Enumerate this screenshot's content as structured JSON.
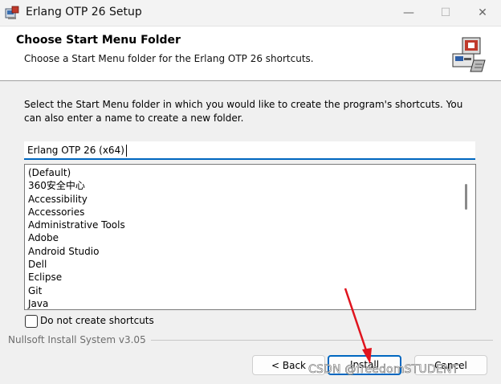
{
  "window": {
    "title": "Erlang OTP 26 Setup",
    "minimize": "—",
    "maximize": "☐",
    "close": "✕"
  },
  "header": {
    "title": "Choose Start Menu Folder",
    "subtitle": "Choose a Start Menu folder for the Erlang OTP 26 shortcuts."
  },
  "instructions": "Select the Start Menu folder in which you would like to create the program's shortcuts. You can also enter a name to create a new folder.",
  "folder_input": {
    "value": "Erlang OTP 26 (x64)"
  },
  "folder_list": {
    "items": [
      "(Default)",
      "360安全中心",
      "Accessibility",
      "Accessories",
      "Administrative Tools",
      "Adobe",
      "Android Studio",
      "Dell",
      "Eclipse",
      "Git",
      "Java"
    ]
  },
  "checkbox": {
    "label": "Do not create shortcuts",
    "checked": false
  },
  "branding": "Nullsoft Install System v3.05",
  "buttons": {
    "back": "< Back",
    "install": "Install",
    "cancel": "Cancel"
  },
  "watermark": "CSDN @freedomSTUDENT",
  "icons": {
    "app": "installer-icon",
    "header": "computer-disk-icon",
    "annotation": "red-arrow"
  },
  "colors": {
    "accent": "#0067c0",
    "arrow": "#e0141e"
  }
}
